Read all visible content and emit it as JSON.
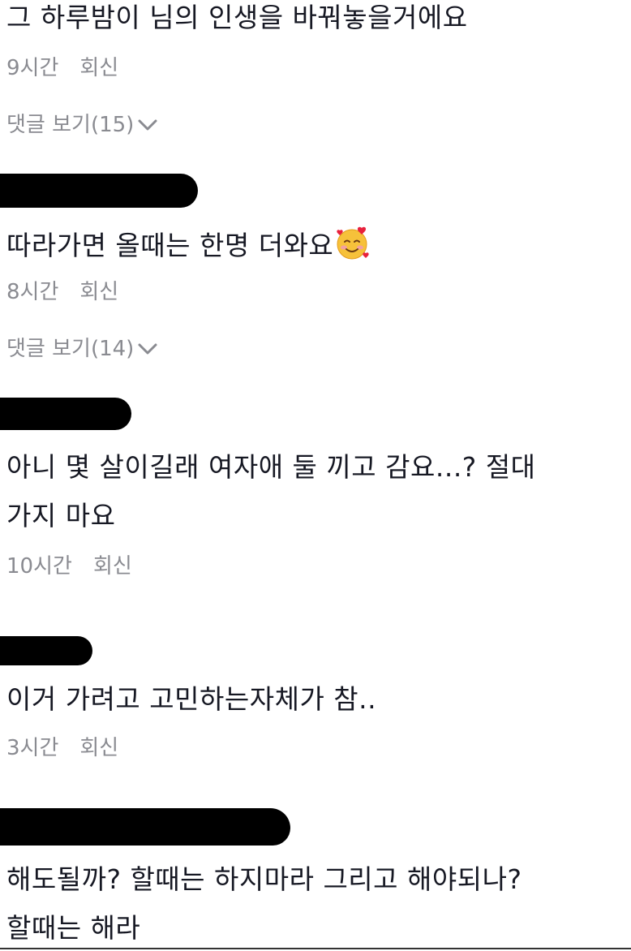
{
  "comments": [
    {
      "text": "그 하루밤이 님의 인생을 바꿔놓을거에요",
      "time": "9시간",
      "reply": "회신",
      "view_replies": "댓글 보기(15)"
    },
    {
      "text": "따라가면 올때는 한명 더와요",
      "emoji": "smiling-face-with-hearts-icon",
      "time": "8시간",
      "reply": "회신",
      "view_replies": "댓글 보기(14)"
    },
    {
      "text_line1": "아니 몇 살이길래 여자애 둘 끼고 감요...? 절대",
      "text_line2": "가지 마요",
      "time": "10시간",
      "reply": "회신"
    },
    {
      "text": "이거 가려고 고민하는자체가 참..",
      "time": "3시간",
      "reply": "회신"
    },
    {
      "text_line1": "해도될까? 할때는 하지마라 그리고 해야되나?",
      "text_line2": "할때는 해라"
    }
  ],
  "colors": {
    "text": "#161823",
    "meta": "#8a8b91",
    "redaction": "#000000"
  }
}
